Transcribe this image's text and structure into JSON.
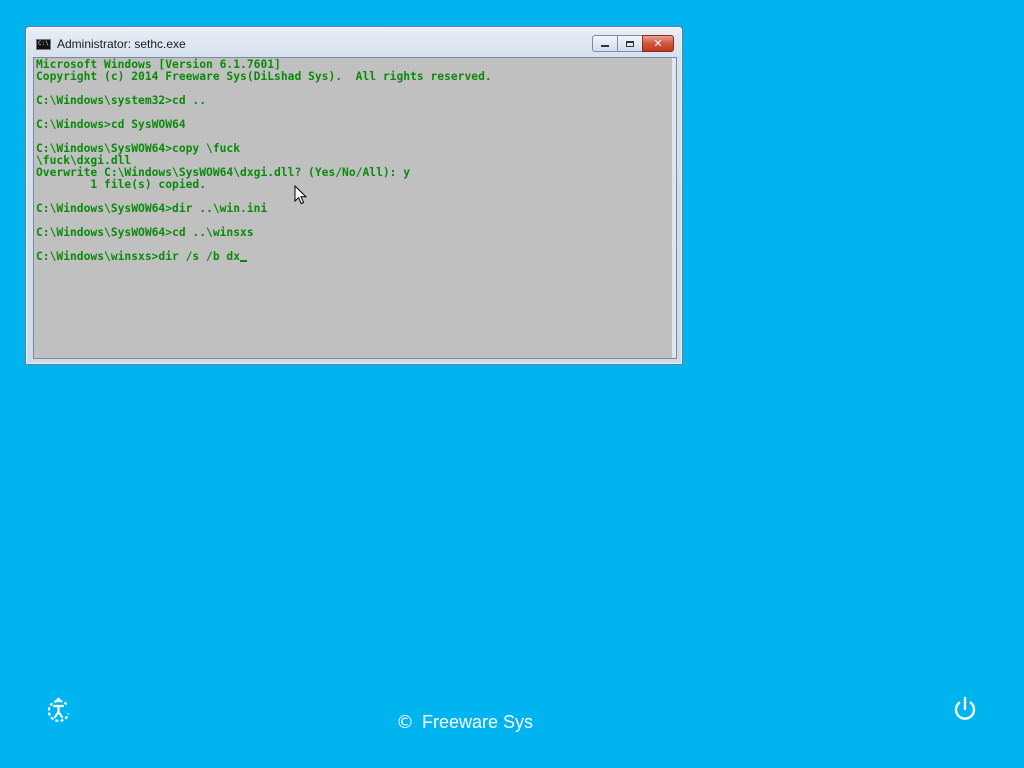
{
  "window": {
    "title": "Administrator: sethc.exe",
    "icon": "console-icon",
    "icon_glyph": "C:\\",
    "buttons": {
      "minimize": "minimize-icon",
      "maximize": "maximize-icon",
      "close_glyph": "✕"
    }
  },
  "console": {
    "lines": [
      "Microsoft Windows [Version 6.1.7601]",
      "Copyright (c) 2014 Freeware Sys(DiLshad Sys).  All rights reserved.",
      "",
      "C:\\Windows\\system32>cd ..",
      "",
      "C:\\Windows>cd SysWOW64",
      "",
      "C:\\Windows\\SysWOW64>copy \\fuck",
      "\\fuck\\dxgi.dll",
      "Overwrite C:\\Windows\\SysWOW64\\dxgi.dll? (Yes/No/All): y",
      "        1 file(s) copied.",
      "",
      "C:\\Windows\\SysWOW64>dir ..\\win.ini",
      "",
      "C:\\Windows\\SysWOW64>cd ..\\winsxs",
      "",
      "C:\\Windows\\winsxs>dir /s /b dx"
    ],
    "text_color": "#0a8a0a",
    "background_color": "#c0c0c0"
  },
  "lock_screen": {
    "background_color": "#00b4ef",
    "brand_symbol": "©",
    "brand_text": "Freeware Sys",
    "ease_of_access_icon": "ease-of-access-icon",
    "power_icon": "power-icon"
  }
}
